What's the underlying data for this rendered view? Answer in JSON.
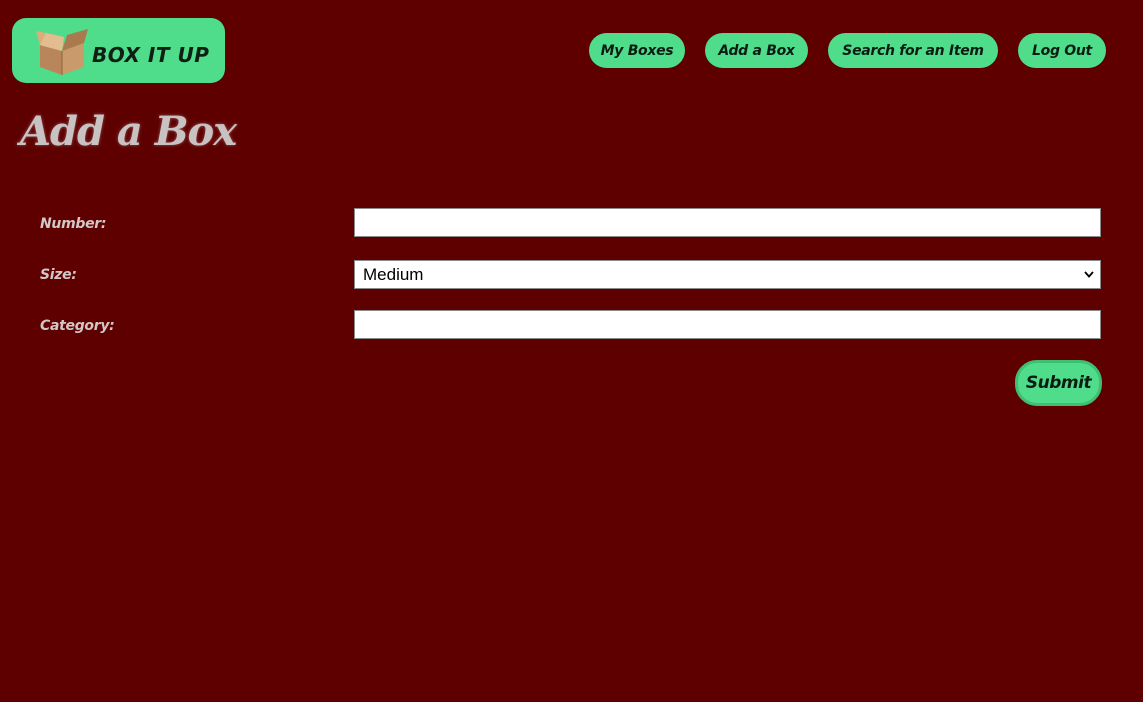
{
  "brand": {
    "name": "BOX IT UP",
    "icon": "cardboard-box-icon",
    "color": "#4fdc8b"
  },
  "nav": {
    "my_boxes": "My Boxes",
    "add_box": "Add a Box",
    "search": "Search for an Item",
    "logout": "Log Out"
  },
  "page": {
    "title": "Add a Box",
    "background": "#5e0000"
  },
  "form": {
    "number": {
      "label": "Number:",
      "value": ""
    },
    "size": {
      "label": "Size:",
      "value": "Medium"
    },
    "category": {
      "label": "Category:",
      "value": ""
    },
    "submit_label": "Submit"
  }
}
